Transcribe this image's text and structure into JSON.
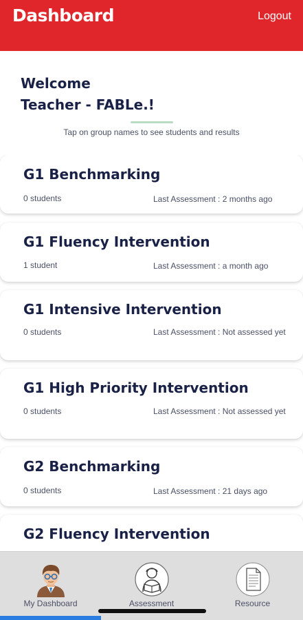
{
  "header": {
    "title": "Dashboard",
    "logout_label": "Logout"
  },
  "welcome": {
    "line1": "Welcome",
    "line2": "Teacher - FABLe.!",
    "hint": "Tap on group names to see students and results"
  },
  "groups": [
    {
      "name": "G1 Benchmarking",
      "students": "0 students",
      "last": "Last Assessment : 2 months ago"
    },
    {
      "name": "G1 Fluency Intervention",
      "students": "1 student",
      "last": "Last Assessment : a month ago"
    },
    {
      "name": "G1 Intensive Intervention",
      "students": "0 students",
      "last": "Last Assessment : Not assessed yet"
    },
    {
      "name": "G1 High Priority Intervention",
      "students": "0 students",
      "last": "Last Assessment : Not assessed yet"
    },
    {
      "name": "G2 Benchmarking",
      "students": "0 students",
      "last": "Last Assessment : 21 days ago"
    },
    {
      "name": "G2 Fluency Intervention",
      "students": "",
      "last": ""
    }
  ],
  "tabs": [
    {
      "label": "My Dashboard",
      "icon": "teacher-avatar-icon",
      "active": true
    },
    {
      "label": "Assessment",
      "icon": "reader-icon",
      "active": false
    },
    {
      "label": "Resource",
      "icon": "document-icon",
      "active": false
    }
  ],
  "colors": {
    "header": "#e1262b",
    "title_text": "#1a2146",
    "accent": "#b9dcc2",
    "active_tab": "#2a7de1"
  }
}
